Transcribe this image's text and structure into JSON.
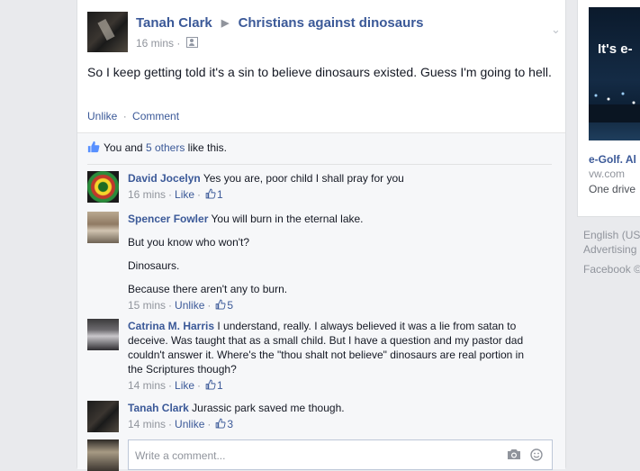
{
  "post": {
    "author": "Tanah Clark",
    "group": "Christians against dinosaurs",
    "time": "16 mins",
    "text": "So I keep getting told it's a sin to believe dinosaurs existed. Guess I'm going to hell.",
    "actions": {
      "unlike": "Unlike",
      "comment": "Comment"
    }
  },
  "likes": {
    "you_and": "You and ",
    "others": "5 others",
    "suffix": " like this."
  },
  "comments": [
    {
      "author": "David Jocelyn",
      "paragraphs": [
        "Yes you are, poor child I shall pray for you"
      ],
      "time": "16 mins",
      "action": "Like",
      "like_count": "1"
    },
    {
      "author": "Spencer Fowler",
      "paragraphs": [
        "You will burn in the eternal lake.",
        "But you know who won't?",
        "Dinosaurs.",
        "Because there aren't any to burn."
      ],
      "time": "15 mins",
      "action": "Unlike",
      "like_count": "5"
    },
    {
      "author": "Catrina M. Harris",
      "paragraphs": [
        "I understand, really. I always believed it was a lie from satan to deceive. Was taught that as a small child. But I have a question and my pastor dad couldn't answer it. Where's the \"thou shalt not believe\" dinosaurs are real portion in the Scriptures though?"
      ],
      "time": "14 mins",
      "action": "Like",
      "like_count": "1"
    },
    {
      "author": "Tanah Clark",
      "paragraphs": [
        "Jurassic park saved me though."
      ],
      "time": "14 mins",
      "action": "Unlike",
      "like_count": "3"
    }
  ],
  "write_comment": {
    "placeholder": "Write a comment..."
  },
  "sidebar": {
    "ad": {
      "image_text": "It's e-",
      "title": "e-Golf. Al",
      "domain": "vw.com",
      "description": "One drive"
    },
    "footer": {
      "language": "English (US",
      "advertising": "Advertising",
      "facebook": "Facebook ©"
    }
  },
  "colors": {
    "link": "#3b5998",
    "background": "#e9eaed",
    "meta": "#90949c"
  },
  "icons": [
    "chevron-down-icon",
    "audience-icon",
    "thumbs-up-icon",
    "camera-icon",
    "smiley-icon"
  ]
}
